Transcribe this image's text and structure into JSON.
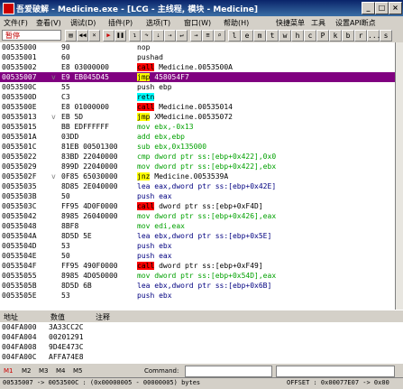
{
  "window": {
    "title": "吾爱破解 - Medicine.exe - [LCG - 主线程, 模块 - Medicine]"
  },
  "menu": [
    "文件(F)",
    "查看(V)",
    "调试(D)",
    "插件(P)",
    "选项(T)",
    "窗口(W)",
    "帮助(H)",
    "快捷菜单",
    "工具",
    "设置API断点"
  ],
  "toolbar": {
    "status": "暂停",
    "letters": [
      "l",
      "e",
      "m",
      "t",
      "w",
      "h",
      "c",
      "P",
      "k",
      "b",
      "r",
      "...",
      "s"
    ]
  },
  "disasm": [
    {
      "addr": "00535000",
      "mk": "",
      "hex": "90",
      "asm": "nop",
      "style": "plain"
    },
    {
      "addr": "00535001",
      "mk": "",
      "hex": "60",
      "asm": "pushad",
      "style": "plain"
    },
    {
      "addr": "00535002",
      "mk": "",
      "hex": "E8 03000000",
      "asm": "call Medicine.0053500A",
      "style": "call"
    },
    {
      "addr": "00535007",
      "mk": "v",
      "hex": "E9 EB045D45",
      "asm": "jmp 458054F7",
      "style": "jmp",
      "selected": true
    },
    {
      "addr": "0053500C",
      "mk": "",
      "hex": "55",
      "asm": "push ebp",
      "style": "plain"
    },
    {
      "addr": "0053500D",
      "mk": "",
      "hex": "C3",
      "asm": "retn",
      "style": "retn"
    },
    {
      "addr": "0053500E",
      "mk": "",
      "hex": "E8 01000000",
      "asm": "call Medicine.00535014",
      "style": "call"
    },
    {
      "addr": "00535013",
      "mk": "v",
      "hex": "EB 5D",
      "asm": "jmp XMedicine.00535072",
      "style": "jmp"
    },
    {
      "addr": "00535015",
      "mk": "",
      "hex": "BB EDFFFFFF",
      "asm": "mov ebx,-0x13",
      "style": "green"
    },
    {
      "addr": "0053501A",
      "mk": "",
      "hex": "03DD",
      "asm": "add ebx,ebp",
      "style": "green"
    },
    {
      "addr": "0053501C",
      "mk": "",
      "hex": "81EB 00501300",
      "asm": "sub ebx,0x135000",
      "style": "green"
    },
    {
      "addr": "00535022",
      "mk": "",
      "hex": "83BD 22040000",
      "asm": "cmp dword ptr ss:[ebp+0x422],0x0",
      "style": "green"
    },
    {
      "addr": "00535029",
      "mk": "",
      "hex": "899D 22040000",
      "asm": "mov dword ptr ss:[ebp+0x422],ebx",
      "style": "green"
    },
    {
      "addr": "0053502F",
      "mk": "v",
      "hex": "0F85 65030000",
      "asm": "jnz Medicine.0053539A",
      "style": "jmp"
    },
    {
      "addr": "00535035",
      "mk": "",
      "hex": "8D85 2E040000",
      "asm": "lea eax,dword ptr ss:[ebp+0x42E]",
      "style": "navy"
    },
    {
      "addr": "0053503B",
      "mk": "",
      "hex": "50",
      "asm": "push eax",
      "style": "navy"
    },
    {
      "addr": "0053503C",
      "mk": "",
      "hex": "FF95 4D0F0000",
      "asm": "call dword ptr ss:[ebp+0xF4D]",
      "style": "call"
    },
    {
      "addr": "00535042",
      "mk": "",
      "hex": "8985 26040000",
      "asm": "mov dword ptr ss:[ebp+0x426],eax",
      "style": "green"
    },
    {
      "addr": "00535048",
      "mk": "",
      "hex": "8BF8",
      "asm": "mov edi,eax",
      "style": "green"
    },
    {
      "addr": "0053504A",
      "mk": "",
      "hex": "8D5D 5E",
      "asm": "lea ebx,dword ptr ss:[ebp+0x5E]",
      "style": "navy"
    },
    {
      "addr": "0053504D",
      "mk": "",
      "hex": "53",
      "asm": "push ebx",
      "style": "navy"
    },
    {
      "addr": "0053504E",
      "mk": "",
      "hex": "50",
      "asm": "push eax",
      "style": "navy"
    },
    {
      "addr": "0053504F",
      "mk": "",
      "hex": "FF95 490F0000",
      "asm": "call dword ptr ss:[ebp+0xF49]",
      "style": "call"
    },
    {
      "addr": "00535055",
      "mk": "",
      "hex": "8985 4D050000",
      "asm": "mov dword ptr ss:[ebp+0x54D],eax",
      "style": "green"
    },
    {
      "addr": "0053505B",
      "mk": "",
      "hex": "8D5D 6B",
      "asm": "lea ebx,dword ptr ss:[ebp+0x6B]",
      "style": "navy"
    },
    {
      "addr": "0053505E",
      "mk": "",
      "hex": "53",
      "asm": "push ebx",
      "style": "navy"
    }
  ],
  "dump": {
    "headers": {
      "address": "地址",
      "value": "数值",
      "comment": "注释"
    },
    "rows": [
      {
        "addr": "004FA000",
        "value": "3A33CC2C"
      },
      {
        "addr": "004FA004",
        "value": "00201291"
      },
      {
        "addr": "004FA008",
        "value": "9D4E473C"
      },
      {
        "addr": "004FA00C",
        "value": "AFFA74E8"
      }
    ]
  },
  "command": {
    "tabs": [
      "M1",
      "M2",
      "M3",
      "M4",
      "M5"
    ],
    "label": "Command:"
  },
  "status": {
    "range": "00535007 -> 0053500C : (0x00000005 - 00000005) bytes",
    "offset": "OFFSET : 0x00077E07 -> 0x00"
  },
  "colors": {
    "call": "#ff0000",
    "jmp": "#ffff00",
    "retn": "#00ffff",
    "selected": "#800080"
  }
}
